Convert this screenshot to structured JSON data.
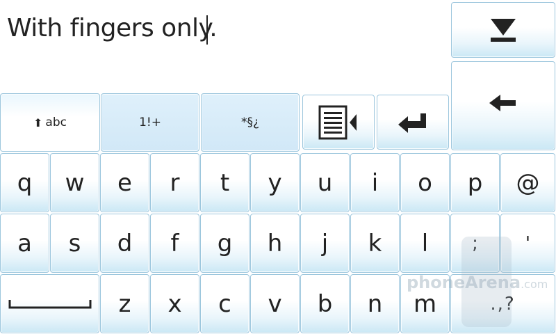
{
  "input": {
    "text": "With fingers only."
  },
  "mode_keys": {
    "alpha": "abc",
    "numbers": "1!+",
    "symbols": "*§¿"
  },
  "rows": {
    "row1": [
      "q",
      "w",
      "e",
      "r",
      "t",
      "y",
      "u",
      "i",
      "o",
      "p",
      "@"
    ],
    "row2": [
      "a",
      "s",
      "d",
      "f",
      "g",
      "h",
      "j",
      "k",
      "l",
      ";",
      "'"
    ],
    "row3": [
      "z",
      "x",
      "c",
      "v",
      "b",
      "n",
      "m",
      ".,?"
    ]
  },
  "watermark": {
    "main": "phoneArena",
    "suffix": ".com"
  },
  "icons": {
    "hide": "hide-keyboard-icon",
    "options": "menu-list-icon",
    "enter": "enter-icon",
    "backspace": "backspace-icon",
    "shift": "shift-arrow-icon",
    "space": "space-bar-icon"
  },
  "colors": {
    "key_border": "#9cc6dd",
    "mode_bg": "#d1e8f7",
    "text": "#222222"
  }
}
